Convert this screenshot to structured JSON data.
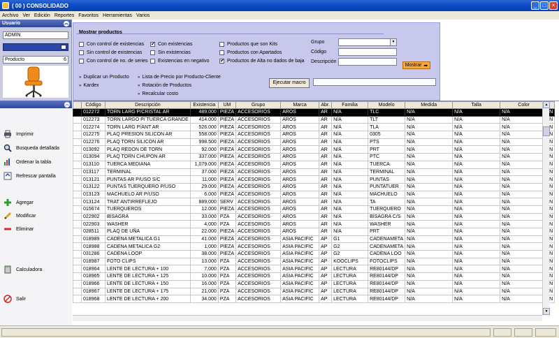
{
  "window": {
    "title": "( 00 ) CONSOLIDADO"
  },
  "menu": [
    "Archivo",
    "Ver",
    "Edición",
    "Reportes",
    "Favoritos",
    "Herramientas",
    "Varios"
  ],
  "left": {
    "header": "Usuario",
    "user": "ADMIN",
    "product_label": "Producto",
    "product_count": "6",
    "actions": [
      {
        "label": "Imprimir",
        "icon": "printer-icon"
      },
      {
        "label": "Busqueda detallada",
        "icon": "magnifier-icon"
      },
      {
        "label": "Ordenar la tabla",
        "icon": "sort-icon"
      },
      {
        "label": "Refrescar pantalla",
        "icon": "refresh-icon"
      },
      {
        "label": "Agregar",
        "icon": "plus-icon"
      },
      {
        "label": "Modificar",
        "icon": "pencil-icon"
      },
      {
        "label": "Eliminar",
        "icon": "minus-icon"
      },
      {
        "label": "Calculadora",
        "icon": "calculator-icon"
      },
      {
        "label": "Salir",
        "icon": "exit-icon"
      }
    ]
  },
  "filters": {
    "title": "Mostrar productos",
    "checks": [
      {
        "label": "Con control de existencias",
        "checked": false
      },
      {
        "label": "Sin control de existencias",
        "checked": false
      },
      {
        "label": "Con control de no. de series",
        "checked": false
      },
      {
        "label": "Con existencias",
        "checked": true
      },
      {
        "label": "Sin existencias",
        "checked": false
      },
      {
        "label": "Existencias en negativo",
        "checked": false
      },
      {
        "label": "Productos que son Kits",
        "checked": false
      },
      {
        "label": "Productos con Apartados",
        "checked": false
      },
      {
        "label": "Productos de Alta no dados de baja",
        "checked": true
      }
    ],
    "grupo_label": "Grupo",
    "codigo_label": "Código",
    "descripcion_label": "Descripción",
    "mostrar_label": "Mostrar",
    "links": [
      "Duplicar un Producto",
      "Kardex",
      "Lista de Precio por Producto-Cliente",
      "Rotación de Productos",
      "Recalcular costo"
    ],
    "macro_label": "Ejecutar macro"
  },
  "table": {
    "columns": [
      "",
      "Código",
      "Descripción",
      "Existencia",
      "UM",
      "Grupo",
      "Marca",
      "Abr.",
      "Familia",
      "Modelo",
      "Medida",
      "Talla",
      "Color",
      ""
    ],
    "rows": [
      [
        "012272",
        "TORN LARG P/CRISTAL AR",
        "489.000",
        "PIEZA",
        "ACCESORIOS",
        "AROS",
        "AR",
        "N/A",
        "TLC",
        "N/A",
        "N/A",
        "N/A",
        "N"
      ],
      [
        "012273",
        "TORN  LARGO P/ TUERCA GRANDE",
        "414.000",
        "PIEZA",
        "ACCESORIOS",
        "AROS",
        "AR",
        "N/A",
        "TLT",
        "N/A",
        "N/A",
        "N/A",
        "N"
      ],
      [
        "012274",
        "TORN LARG P/ANT AR",
        "526.000",
        "PIEZA",
        "ACCESORIOS",
        "AROS",
        "AR",
        "N/A",
        "TLA",
        "N/A",
        "N/A",
        "N/A",
        "N"
      ],
      [
        "012275",
        "PLAQ PRESION SILICON AR",
        "558.000",
        "PIEZA",
        "ACCESORIOS",
        "AROS",
        "AR",
        "N/A",
        "0305",
        "N/A",
        "N/A",
        "N/A",
        "N"
      ],
      [
        "012276",
        "PLAQ TORN SILICON AR",
        "998.500",
        "PIEZA",
        "ACCESORIOS",
        "AROS",
        "AR",
        "N/A",
        "PTS",
        "N/A",
        "N/A",
        "N/A",
        "N"
      ],
      [
        "013092",
        "PLAQ REDON DE TORN",
        "92.000",
        "PIEZA",
        "ACCESORIOS",
        "AROS",
        "AR",
        "N/A",
        "PRT",
        "N/A",
        "N/A",
        "N/A",
        "N"
      ],
      [
        "013094",
        "PLAQ TORN CHUPON AR",
        "337.000",
        "PIEZA",
        "ACCESORIOS",
        "AROS",
        "AR",
        "N/A",
        "PTC",
        "N/A",
        "N/A",
        "N/A",
        "N"
      ],
      [
        "013110",
        "TUERCA MEDIANA",
        "1,079.000",
        "PIEZA",
        "ACCESORIOS",
        "AROS",
        "AR",
        "N/A",
        "TUERCA",
        "N/A",
        "N/A",
        "N/A",
        "N"
      ],
      [
        "013117",
        "TERMINAL",
        "37.000",
        "PIEZA",
        "ACCESORIOS",
        "AROS",
        "AR",
        "N/A",
        "TERMINAL",
        "N/A",
        "N/A",
        "N/A",
        "N"
      ],
      [
        "013121",
        "PUNTAS AR P/USO S/C",
        "11.000",
        "PIEZA",
        "ACCESORIOS",
        "AROS",
        "AR",
        "N/A",
        "PUNTAS",
        "N/A",
        "N/A",
        "N/A",
        "N"
      ],
      [
        "013122",
        "PUNTAS TUERQUERO P/USO",
        "29.000",
        "PIEZA",
        "ACCESORIOS",
        "AROS",
        "AR",
        "N/A",
        "PUNTATUER",
        "N/A",
        "N/A",
        "N/A",
        "N"
      ],
      [
        "013123",
        "MACHUELO AR P/USO",
        "6.000",
        "PIEZA",
        "ACCESORIOS",
        "AROS",
        "AR",
        "N/A",
        "MACHUELO",
        "N/A",
        "N/A",
        "N/A",
        "N"
      ],
      [
        "013124",
        "TRAT ANTIRREFLEJO",
        "889.000",
        "SERV",
        "ACCESORIOS",
        "AROS",
        "AR",
        "N/A",
        "TA",
        "N/A",
        "N/A",
        "N/A",
        "N"
      ],
      [
        "015674",
        "TUERQUEROS",
        "12.000",
        "PIEZA",
        "ACCESORIOS",
        "AROS",
        "AR",
        "N/A",
        "TUERQUERO",
        "N/A",
        "N/A",
        "N/A",
        "N"
      ],
      [
        "022902",
        "BISAGRA",
        "33.000",
        "PZA",
        "ACCESORIOS",
        "AROS",
        "AR",
        "N/A",
        "BISAGRA C/S",
        "N/A",
        "N/A",
        "N/A",
        "N"
      ],
      [
        "022903",
        "WASHER",
        "4.000",
        "PZA",
        "ACCESORIOS",
        "AROS",
        "AR",
        "N/A",
        "WASHER",
        "N/A",
        "N/A",
        "N/A",
        "N"
      ],
      [
        "028511",
        "PLAQ DE UÑA",
        "22.000",
        "PIEZA",
        "ACCESORIOS",
        "AROS",
        "AR",
        "N/A",
        "PRT",
        "N/A",
        "N/A",
        "N/A",
        "N"
      ],
      [
        "018989",
        "CADENA METALICA G1",
        "41.000",
        "PIEZA",
        "ACCESORIOS",
        "ASIA PACIFIC",
        "AP",
        "G1",
        "CADENAMETA",
        "N/A",
        "N/A",
        "N/A",
        "N"
      ],
      [
        "018988",
        "CADENA METALICA G2",
        "1.000",
        "PIEZA",
        "ACCESORIOS",
        "ASIA PACIFIC",
        "AP",
        "G2",
        "CADENAMETA",
        "N/A",
        "N/A",
        "N/A",
        "N"
      ],
      [
        "031286",
        "CADENA LOOP",
        "38.000",
        "PIEZA",
        "ACCESORIOS",
        "ASIA PACIFIC",
        "AP",
        "G2",
        "CADENA LOO",
        "N/A",
        "N/A",
        "N/A",
        "N"
      ],
      [
        "018987",
        "FOTO CLIPS",
        "13.000",
        "PZA",
        "ACCESORIOS",
        "ASIA PACIFIC",
        "AP",
        "KOOCLIPS",
        "FOTOCLIPS",
        "N/A",
        "N/A",
        "N/A",
        "N"
      ],
      [
        "018964",
        "LENTE DE LECTURA + 100",
        "7.000",
        "PZA",
        "ACCESORIOS",
        "ASIA PACIFIC",
        "AP",
        "LECTURA",
        "RE80144/DP",
        "N/A",
        "N/A",
        "N/A",
        "N"
      ],
      [
        "018965",
        "LENTE DE LECTURA + 125",
        "10.000",
        "PZA",
        "ACCESORIOS",
        "ASIA PACIFIC",
        "AP",
        "LECTURA",
        "RE80144/DP",
        "N/A",
        "N/A",
        "N/A",
        "N"
      ],
      [
        "018966",
        "LENTE DE LECTURA + 150",
        "16.000",
        "PZA",
        "ACCESORIOS",
        "ASIA PACIFIC",
        "AP",
        "LECTURA",
        "RE80144/DP",
        "N/A",
        "N/A",
        "N/A",
        "N"
      ],
      [
        "018967",
        "LENTE DE LECTURA + 175",
        "21.000",
        "PZA",
        "ACCESORIOS",
        "ASIA PACIFIC",
        "AP",
        "LECTURA",
        "RE80144/DP",
        "N/A",
        "N/A",
        "N/A",
        "N"
      ],
      [
        "018968",
        "LENTE DE LECTURA + 200",
        "34.000",
        "PZA",
        "ACCESORIOS",
        "ASIA PACIFIC",
        "AP",
        "LECTURA",
        "RE80144/DP",
        "N/A",
        "N/A",
        "N/A",
        "N"
      ]
    ]
  }
}
